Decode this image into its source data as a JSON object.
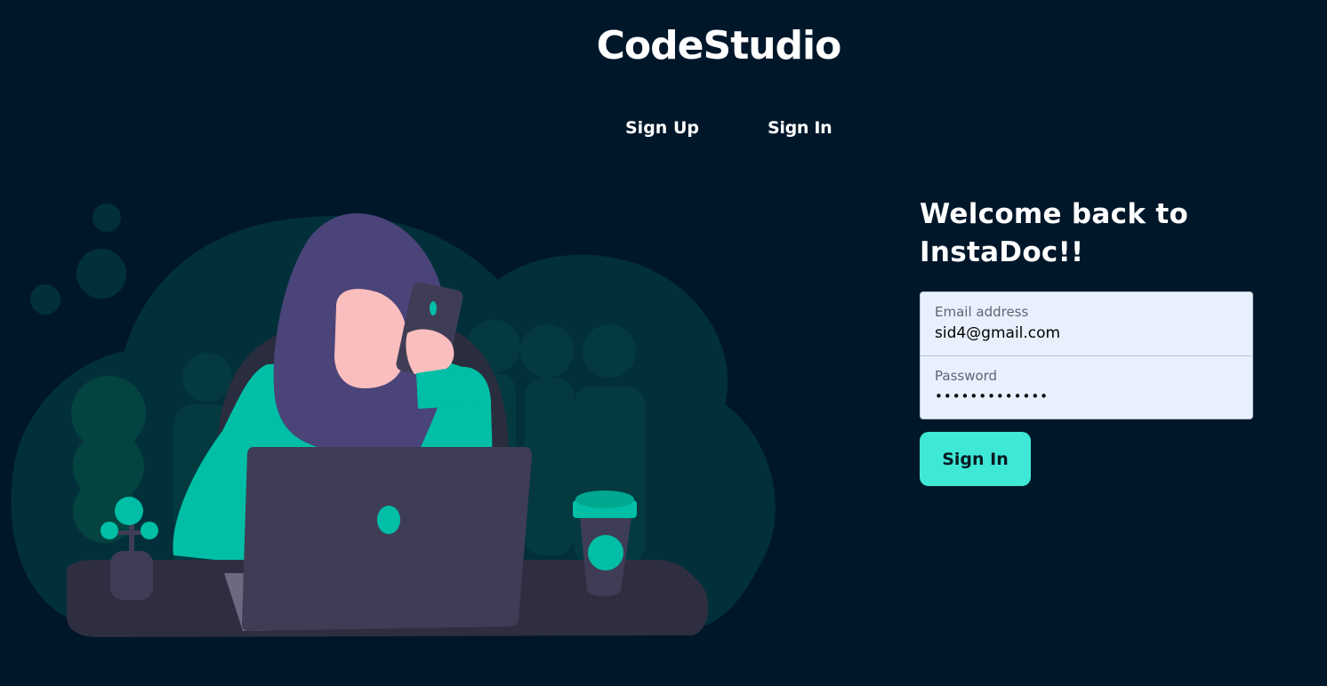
{
  "brand": {
    "name": "CodeStudio"
  },
  "nav": {
    "items": [
      "Sign Up",
      "Sign In"
    ]
  },
  "form": {
    "heading": "Welcome back to InstaDoc!!",
    "email_label": "Email address",
    "email_value": "sid4@gmail.com",
    "password_label": "Password",
    "password_value": "sid4password!",
    "submit_label": "Sign In"
  },
  "colors": {
    "background": "#00172a",
    "accent": "#3ee8d4",
    "input_bg": "#e8f0fe"
  },
  "illustration": {
    "icon": "woman-at-laptop-illustration"
  }
}
